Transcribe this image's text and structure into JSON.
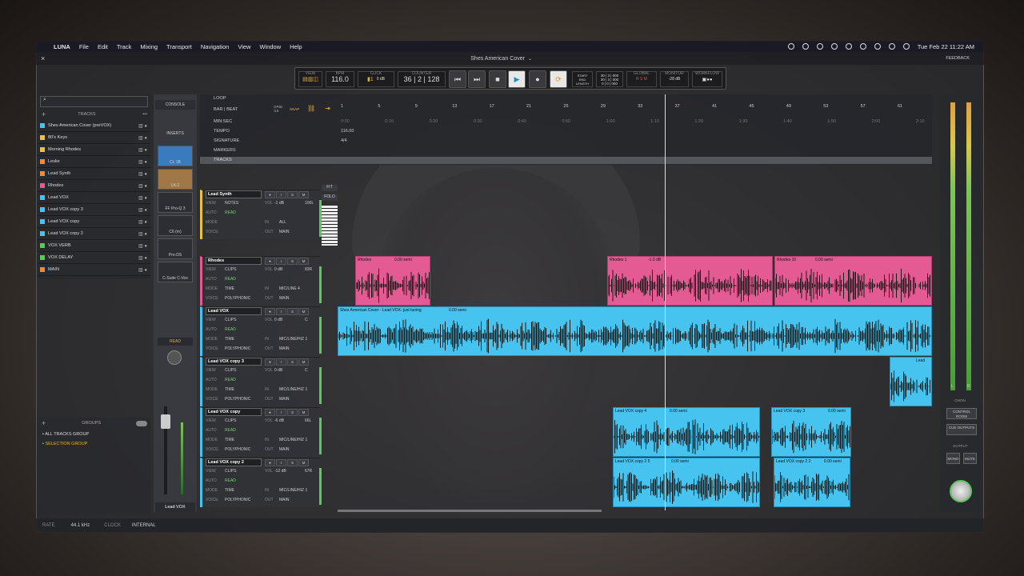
{
  "menubar": {
    "apple": "",
    "app": "LUNA",
    "items": [
      "File",
      "Edit",
      "Track",
      "Mixing",
      "Transport",
      "Navigation",
      "View",
      "Window",
      "Help"
    ],
    "clock": "Tue Feb 22  11:22 AM"
  },
  "titlebar": {
    "title": "Shes American Cover",
    "feedback": "FEEDBACK"
  },
  "transport": {
    "labels": {
      "view": "VIEW",
      "bpm": "BPM",
      "click": "CLICK",
      "counter": "COUNTER",
      "global": "GLOBAL",
      "monitor": "MONITOR",
      "workflow": "WORKFLOW",
      "start": "START",
      "end": "END",
      "length": "LENGTH"
    },
    "bpm": "116.0",
    "click_level": "0 dB",
    "counter": "36 | 2 | 128",
    "start_val": "30 | 3 | 000",
    "end_val": "30 | 3 | 000",
    "length_val": "0 | 0 | 000",
    "monitor_level": "-28 dB"
  },
  "tracks_panel": {
    "header": "TRACKS",
    "items": [
      {
        "name": "Shes American Cover (preVOX)",
        "color": "#46c3ef"
      },
      {
        "name": "80's Keys",
        "color": "#e8c43a"
      },
      {
        "name": "Morning Rhodes",
        "color": "#e8c43a"
      },
      {
        "name": "Leslie",
        "color": "#f08a3a"
      },
      {
        "name": "Lead Synth",
        "color": "#f08a3a"
      },
      {
        "name": "Rhodes",
        "color": "#e45b93"
      },
      {
        "name": "Lead VOX",
        "color": "#46c3ef"
      },
      {
        "name": "Lead VOX copy 3",
        "color": "#46c3ef"
      },
      {
        "name": "Lead VOX copy",
        "color": "#46c3ef"
      },
      {
        "name": "Lead VOX copy 2",
        "color": "#46c3ef"
      },
      {
        "name": "VOX VERB",
        "color": "#5ac85a"
      },
      {
        "name": "VOX DELAY",
        "color": "#5ac85a"
      },
      {
        "name": "MAIN",
        "color": "#f08a3a"
      }
    ]
  },
  "groups": {
    "header": "GROUPS",
    "items": [
      "ALL TRACKS GROUP",
      "SELECTION GROUP"
    ]
  },
  "console": {
    "console_btn": "CONSOLE",
    "inserts": "INSERTS",
    "plugins": [
      "CL 1B",
      "LA-2",
      "FF Pro-Q 3",
      "C6 (m)",
      "Pro-DS",
      "C-Suite C-Vox"
    ],
    "read": "READ",
    "track_name": "Lead VOX"
  },
  "ruler": {
    "loop": "LOOP",
    "bar_beat": "BAR | BEAT",
    "grid": "GRID",
    "grid_val": "/16",
    "snap": "SNAP",
    "minsec": "MIN:SEC",
    "tempo": "TEMPO",
    "tempo_val": "116.00",
    "signature": "SIGNATURE",
    "signature_val": "4/4",
    "markers": "MARKERS",
    "tracks": "TRACKS",
    "bars": [
      "1",
      "5",
      "9",
      "13",
      "17",
      "21",
      "25",
      "29",
      "33",
      "37",
      "41",
      "45",
      "49",
      "53",
      "57",
      "61"
    ],
    "times": [
      "0:00",
      "0:10",
      "0:20",
      "0:30",
      "0:40",
      "0:50",
      "1:00",
      "1:10",
      "1:20",
      "1:30",
      "1:40",
      "1:50",
      "2:00",
      "2:10"
    ]
  },
  "track_headers": [
    {
      "name": "Lead Synth",
      "view": "NOTES",
      "vol": "-1 dB",
      "pan": "100L",
      "pan2": "100R",
      "auto": "READ",
      "time": "",
      "mode": "",
      "in": "ALL",
      "out": "MAIN"
    },
    {
      "name": "Rhodes",
      "view": "CLIPS",
      "vol": "0 dB",
      "pan": "83R",
      "auto": "READ",
      "time": "TIME",
      "in": "MIC/LINE 4",
      "mode": "POLYPHONIC",
      "out": "MAIN"
    },
    {
      "name": "Lead VOX",
      "view": "CLIPS",
      "vol": "0 dB",
      "pan": "C",
      "auto": "READ",
      "time": "TIME",
      "in": "MIC/LINE/HIZ 1",
      "mode": "POLYPHONIC",
      "out": "MAIN"
    },
    {
      "name": "Lead VOX copy 3",
      "view": "CLIPS",
      "vol": "0 dB",
      "pan": "C",
      "auto": "READ",
      "time": "TIME",
      "in": "MIC/LINE/HIZ 1",
      "mode": "POLYPHONIC",
      "out": "MAIN"
    },
    {
      "name": "Lead VOX copy",
      "view": "CLIPS",
      "vol": "-6 dB",
      "pan": "66L",
      "auto": "READ",
      "time": "TIME",
      "in": "MIC/LINE/HIZ 1",
      "mode": "POLYPHONIC",
      "out": "MAIN"
    },
    {
      "name": "Lead VOX copy 2",
      "view": "CLIPS",
      "vol": "-12 dB",
      "pan": "67R",
      "auto": "READ",
      "time": "TIME",
      "in": "MIC/LINE/HIZ 1",
      "mode": "POLYPHONIC",
      "out": "MAIN"
    }
  ],
  "clips": [
    {
      "title": "Rhodes",
      "info": "0.00 semi"
    },
    {
      "title": "Rhodes 1",
      "info": "-1.0 dB"
    },
    {
      "title": "Rhodes 10",
      "info": "0.00 semi"
    },
    {
      "title": "Shes American Cover - Lead VOX- just tuning",
      "info": "0.00 semi"
    },
    {
      "title": "Lead VOX copy 4",
      "info": "0.00 semi"
    },
    {
      "title": "Lead VOX copy 3",
      "info": "0.00 semi"
    },
    {
      "title": "Lead VOX copy 2 5",
      "info": "0.00 semi"
    },
    {
      "title": "Lead VOX copy 2 2",
      "info": "0.00 semi"
    },
    {
      "title": "Lead",
      "info": ""
    }
  ],
  "right_panel": {
    "cmon": "CMON",
    "control_room": "CONTROL ROOM",
    "cue_outputs": "CUE OUTPUTS",
    "output": "OUTPUT",
    "mono": "MONO",
    "mute": "MUTE",
    "l": "L",
    "r": "R"
  },
  "statusbar": {
    "rate_label": "RATE",
    "rate": "44.1 kHz",
    "clock_label": "CLOCK",
    "clock": "INTERNAL"
  },
  "fit": "FIT",
  "folo": "FOLO"
}
